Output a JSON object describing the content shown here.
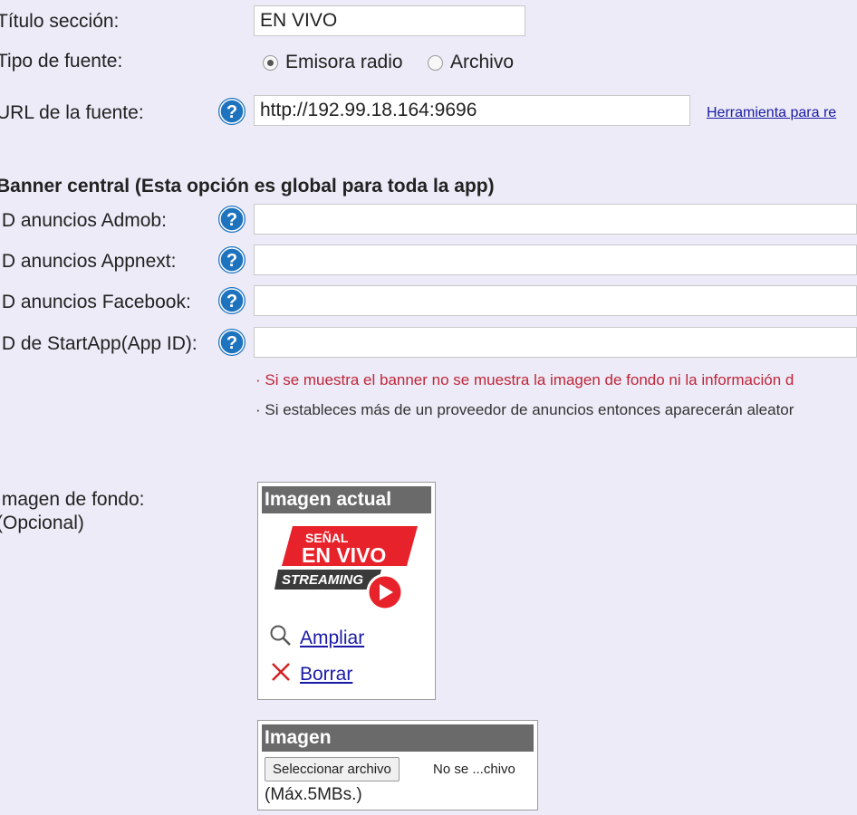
{
  "form": {
    "titulo_label": "Título sección:",
    "titulo_value": "EN VIVO",
    "tipo_label": "Tipo de fuente:",
    "radio_emisora": "Emisora radio",
    "radio_archivo": "Archivo",
    "selected_tipo": "Emisora radio",
    "url_label": "URL de la fuente:",
    "url_value": "http://192.99.18.164:9696",
    "url_tool_link": "Herramienta para re"
  },
  "banner": {
    "section_title": "Banner central (Esta opción es global para toda la app)",
    "admob_label": "ID anuncios Admob:",
    "appnext_label": "ID anuncios Appnext:",
    "facebook_label": "ID anuncios Facebook:",
    "startapp_label": "ID de StartApp(App ID):",
    "note_red": "· Si se muestra el banner no se muestra la imagen de fondo ni la información d",
    "note_gray": "· Si estableces más de un proveedor de anuncios entonces aparecerán aleator"
  },
  "background_image": {
    "label_line1": "Imagen de fondo:",
    "label_line2": "(Opcional)",
    "current_box_title": "Imagen actual",
    "logo_line1": "SEÑAL",
    "logo_line2": "EN VIVO",
    "logo_line3": "STREAMING",
    "zoom_link": "Ampliar",
    "delete_link": "Borrar",
    "upload_box_title": "Imagen",
    "choose_file_button": "Seleccionar archivo",
    "file_status": "No se ...chivo",
    "max_size": "(Máx.5MBs.)"
  },
  "colors": {
    "page_bg": "#ecebf7",
    "help_icon": "#1e73be",
    "red_note": "#c0263a",
    "link": "#1a1aa6",
    "logo_red": "#e8222a"
  }
}
